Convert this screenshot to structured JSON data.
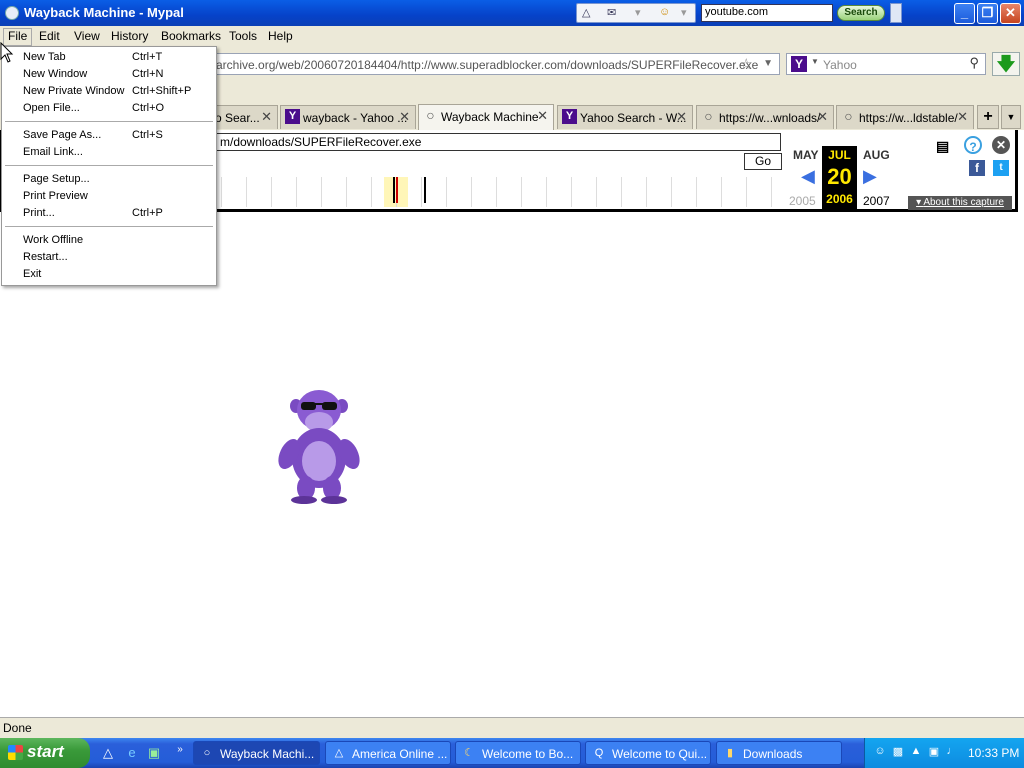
{
  "window": {
    "title": "Wayback Machine - Mypal"
  },
  "aol_toolbar": {
    "search_value": "youtube.com",
    "search_button": "Search"
  },
  "menubar": {
    "items": [
      "File",
      "Edit",
      "View",
      "History",
      "Bookmarks",
      "Tools",
      "Help"
    ]
  },
  "file_menu": {
    "items": [
      {
        "label": "New Tab",
        "shortcut": "Ctrl+T"
      },
      {
        "label": "New Window",
        "shortcut": "Ctrl+N"
      },
      {
        "label": "New Private Window",
        "shortcut": "Ctrl+Shift+P"
      },
      {
        "label": "Open File...",
        "shortcut": "Ctrl+O"
      },
      {
        "label": "Save Page As...",
        "shortcut": "Ctrl+S"
      },
      {
        "label": "Email Link...",
        "shortcut": ""
      },
      {
        "label": "Page Setup...",
        "shortcut": ""
      },
      {
        "label": "Print Preview",
        "shortcut": ""
      },
      {
        "label": "Print...",
        "shortcut": "Ctrl+P"
      },
      {
        "label": "Work Offline",
        "shortcut": ""
      },
      {
        "label": "Restart...",
        "shortcut": ""
      },
      {
        "label": "Exit",
        "shortcut": ""
      }
    ]
  },
  "navbar": {
    "url": "archive.org/web/20060720184404/http://www.superadblocker.com/downloads/SUPERFileRecover.exe",
    "search_placeholder": "Yahoo"
  },
  "tabs": [
    {
      "label": "o Sear...",
      "icon": "yahoo-icon"
    },
    {
      "label": "wayback - Yahoo ...",
      "icon": "yahoo-icon"
    },
    {
      "label": "Wayback Machine",
      "icon": "globe-icon",
      "active": true
    },
    {
      "label": "Yahoo Search - W...",
      "icon": "yahoo-icon"
    },
    {
      "label": "https://w...wnloads/",
      "icon": "globe-icon"
    },
    {
      "label": "https://w...ldstable/",
      "icon": "globe-icon"
    }
  ],
  "wayback": {
    "url_field": "m/downloads/SUPERFileRecover.exe",
    "go_label": "Go",
    "prev_month": "MAY",
    "cur_month": "JUL",
    "next_month": "AUG",
    "cur_day": "20",
    "prev_year": "2005",
    "cur_year": "2006",
    "next_year": "2007",
    "about_label": "About this capture"
  },
  "status": {
    "text": "Done"
  },
  "taskbar": {
    "start_label": "start",
    "tasks": [
      {
        "label": "Wayback Machi...",
        "active": true
      },
      {
        "label": "America Online ..."
      },
      {
        "label": "Welcome to Bo..."
      },
      {
        "label": "Welcome to Qui..."
      },
      {
        "label": "Downloads"
      }
    ],
    "clock": "10:33 PM"
  }
}
